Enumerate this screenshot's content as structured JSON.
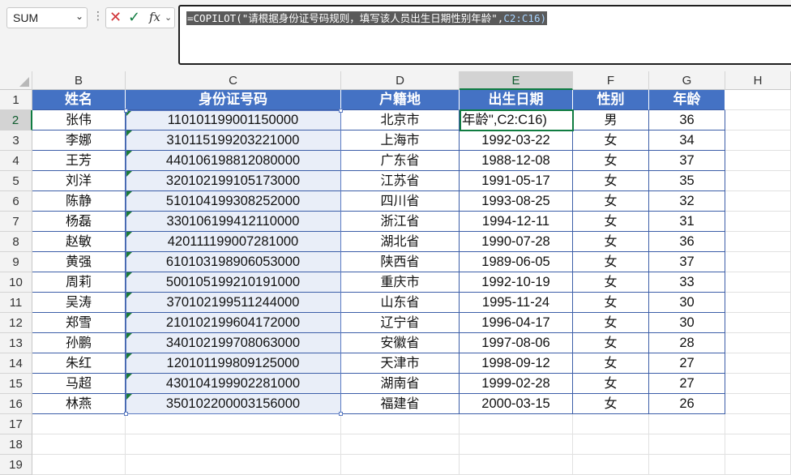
{
  "namebox": {
    "value": "SUM"
  },
  "formula": {
    "text_main": "=COPILOT(\"请根据身份证号码规则，填写该人员出生日期性别年龄\",",
    "text_ref": "C2:C16)"
  },
  "columns": [
    "B",
    "C",
    "D",
    "E",
    "F",
    "G",
    "H"
  ],
  "active_column": "E",
  "rows": [
    "1",
    "2",
    "3",
    "4",
    "5",
    "6",
    "7",
    "8",
    "9",
    "10",
    "11",
    "12",
    "13",
    "14",
    "15",
    "16",
    "17",
    "18",
    "19"
  ],
  "active_row": "2",
  "table": {
    "headers": [
      "姓名",
      "身份证号码",
      "户籍地",
      "出生日期",
      "性别",
      "年龄"
    ],
    "editing_text": "年龄\",C2:C16)",
    "records": [
      [
        "张伟",
        "110101199001150000",
        "北京市",
        "",
        "男",
        "36"
      ],
      [
        "李娜",
        "310115199203221000",
        "上海市",
        "1992-03-22",
        "女",
        "34"
      ],
      [
        "王芳",
        "440106198812080000",
        "广东省",
        "1988-12-08",
        "女",
        "37"
      ],
      [
        "刘洋",
        "320102199105173000",
        "江苏省",
        "1991-05-17",
        "女",
        "35"
      ],
      [
        "陈静",
        "510104199308252000",
        "四川省",
        "1993-08-25",
        "女",
        "32"
      ],
      [
        "杨磊",
        "330106199412110000",
        "浙江省",
        "1994-12-11",
        "女",
        "31"
      ],
      [
        "赵敏",
        "420111199007281000",
        "湖北省",
        "1990-07-28",
        "女",
        "36"
      ],
      [
        "黄强",
        "610103198906053000",
        "陕西省",
        "1989-06-05",
        "女",
        "37"
      ],
      [
        "周莉",
        "500105199210191000",
        "重庆市",
        "1992-10-19",
        "女",
        "33"
      ],
      [
        "吴涛",
        "370102199511244000",
        "山东省",
        "1995-11-24",
        "女",
        "30"
      ],
      [
        "郑雪",
        "210102199604172000",
        "辽宁省",
        "1996-04-17",
        "女",
        "30"
      ],
      [
        "孙鹏",
        "340102199708063000",
        "安徽省",
        "1997-08-06",
        "女",
        "28"
      ],
      [
        "朱红",
        "120101199809125000",
        "天津市",
        "1998-09-12",
        "女",
        "27"
      ],
      [
        "马超",
        "430104199902281000",
        "湖南省",
        "1999-02-28",
        "女",
        "27"
      ],
      [
        "林燕",
        "350102200003156000",
        "福建省",
        "2000-03-15",
        "女",
        "26"
      ]
    ]
  },
  "colors": {
    "header_fill": "#4472c4",
    "selection_fill": "#e9eef8",
    "active_green": "#107c41"
  },
  "icons": {
    "cancel": "x-icon",
    "enter": "check-icon",
    "function": "fx-icon"
  }
}
